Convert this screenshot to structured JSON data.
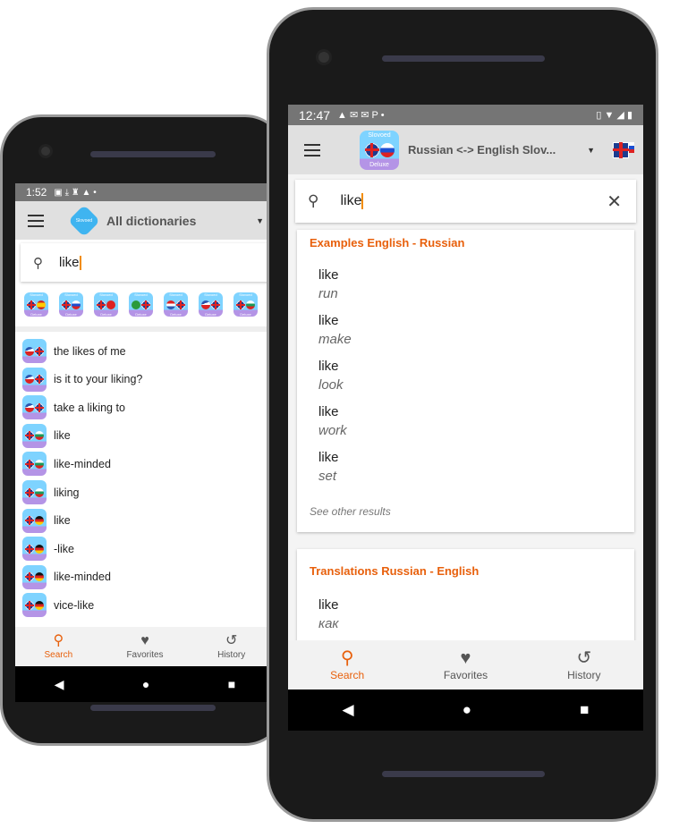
{
  "left_phone": {
    "status": {
      "time": "1:52"
    },
    "header": {
      "logo_text": "Slovoed",
      "title": "All dictionaries"
    },
    "search": {
      "value": "like"
    },
    "dict_icons": [
      {
        "top": "Slovoed",
        "bottom": "Deluxe",
        "flags": [
          "uk",
          "es"
        ]
      },
      {
        "top": "Slovoed",
        "bottom": "Deluxe",
        "flags": [
          "uk",
          "ru"
        ]
      },
      {
        "top": "Slovoed",
        "bottom": "Deluxe",
        "flags": [
          "uk",
          "tr"
        ]
      },
      {
        "top": "Slovoed",
        "bottom": "Deluxe",
        "flags": [
          "br",
          "uk"
        ]
      },
      {
        "top": "Slovoed",
        "bottom": "Deluxe",
        "flags": [
          "hr",
          "uk"
        ]
      },
      {
        "top": "Slovoed",
        "bottom": "Deluxe",
        "flags": [
          "cz",
          "uk"
        ]
      },
      {
        "top": "Slovoed",
        "bottom": "Deluxe",
        "flags": [
          "uk",
          "bg"
        ]
      }
    ],
    "results": [
      {
        "text": "the likes of me",
        "flags": [
          "cz",
          "uk"
        ]
      },
      {
        "text": "is it to your liking?",
        "flags": [
          "cz",
          "uk"
        ]
      },
      {
        "text": "take a liking to",
        "flags": [
          "cz",
          "uk"
        ]
      },
      {
        "text": "like",
        "flags": [
          "uk",
          "bg"
        ]
      },
      {
        "text": "like-minded",
        "flags": [
          "uk",
          "bg"
        ]
      },
      {
        "text": "liking",
        "flags": [
          "uk",
          "bg"
        ]
      },
      {
        "text": "like",
        "flags": [
          "uk",
          "de"
        ]
      },
      {
        "text": "-like",
        "flags": [
          "uk",
          "de"
        ]
      },
      {
        "text": "like-minded",
        "flags": [
          "uk",
          "de"
        ]
      },
      {
        "text": "vice-like",
        "flags": [
          "uk",
          "de"
        ]
      }
    ],
    "bottom_nav": [
      {
        "label": "Search",
        "icon": "search-icon",
        "active": true
      },
      {
        "label": "Favorites",
        "icon": "heart-icon"
      },
      {
        "label": "History",
        "icon": "history-icon"
      }
    ]
  },
  "right_phone": {
    "status": {
      "time": "12:47"
    },
    "header": {
      "logo_top": "Slovoed",
      "logo_bottom": "Deluxe",
      "title": "Russian <-> English Slov..."
    },
    "search": {
      "value": "like"
    },
    "examples": {
      "title": "Examples English - Russian",
      "entries": [
        {
          "word": "like",
          "translation": "run"
        },
        {
          "word": "like",
          "translation": "make"
        },
        {
          "word": "like",
          "translation": "look"
        },
        {
          "word": "like",
          "translation": "work"
        },
        {
          "word": "like",
          "translation": "set"
        }
      ],
      "more": "See other results"
    },
    "translations": {
      "title": "Translations Russian - English",
      "entries": [
        {
          "word": "like",
          "translation": "как"
        }
      ]
    },
    "bottom_nav": [
      {
        "label": "Search",
        "icon": "search-icon",
        "active": true
      },
      {
        "label": "Favorites",
        "icon": "heart-icon"
      },
      {
        "label": "History",
        "icon": "history-icon"
      }
    ]
  },
  "colors": {
    "accent": "#e8600c",
    "status_bar": "#757575",
    "header": "#e0e0e0"
  }
}
